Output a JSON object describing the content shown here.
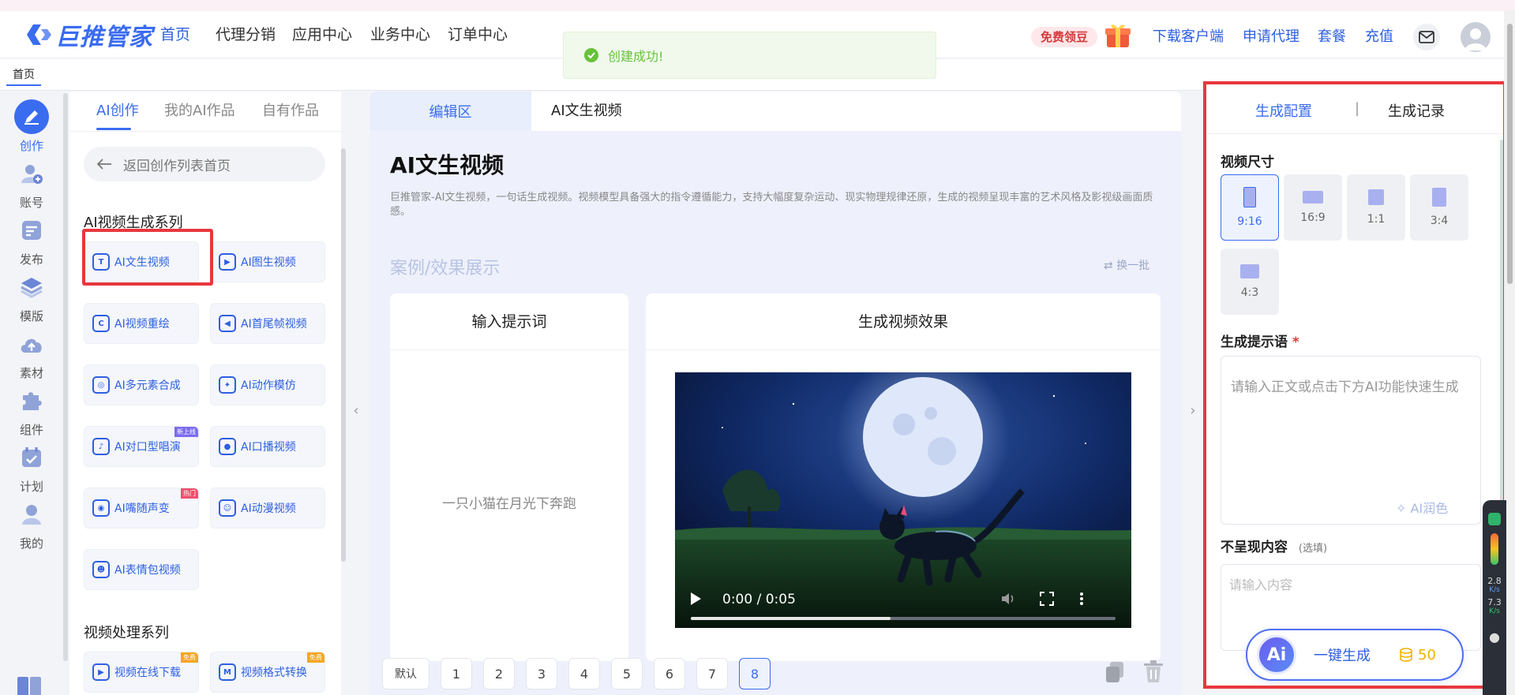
{
  "app": {
    "logo_text": "巨推管家",
    "accent_color": "#3a6cf0",
    "highlight_color": "#e8383d",
    "toast": {
      "text": "创建成功!",
      "icon": "check-circle-icon",
      "color": "#67c23a"
    }
  },
  "header": {
    "nav": [
      "首页",
      "代理分销",
      "应用中心",
      "业务中心",
      "订单中心"
    ],
    "free_beans": "免费领豆",
    "links": [
      "下载客户端",
      "申请代理",
      "套餐",
      "充值"
    ]
  },
  "tabbar": {
    "home_tab": "首页"
  },
  "rail": {
    "items": [
      {
        "label": "创作",
        "icon": "pen-icon"
      },
      {
        "label": "账号",
        "icon": "user-add-icon"
      },
      {
        "label": "发布",
        "icon": "publish-icon"
      },
      {
        "label": "模版",
        "icon": "layers-icon"
      },
      {
        "label": "素材",
        "icon": "cloud-upload-icon"
      },
      {
        "label": "组件",
        "icon": "puzzle-icon"
      },
      {
        "label": "计划",
        "icon": "calendar-check-icon"
      },
      {
        "label": "我的",
        "icon": "person-icon"
      }
    ]
  },
  "leftpanel": {
    "tabs": [
      "AI创作",
      "我的AI作品",
      "自有作品"
    ],
    "back_label": "返回创作列表首页",
    "section1_title": "AI视频生成系列",
    "section1_items": [
      {
        "label": "AI文生视频",
        "badge": ""
      },
      {
        "label": "AI图生视频",
        "badge": ""
      },
      {
        "label": "AI视频重绘",
        "badge": ""
      },
      {
        "label": "AI首尾帧视频",
        "badge": ""
      },
      {
        "label": "AI多元素合成",
        "badge": ""
      },
      {
        "label": "AI动作模仿",
        "badge": ""
      },
      {
        "label": "AI对口型唱演",
        "badge": "新上线"
      },
      {
        "label": "AI口播视频",
        "badge": ""
      },
      {
        "label": "AI嘴随声变",
        "badge": "热门"
      },
      {
        "label": "AI动漫视频",
        "badge": ""
      },
      {
        "label": "AI表情包视频",
        "badge": ""
      }
    ],
    "section2_title": "视频处理系列",
    "section2_items": [
      {
        "label": "视频在线下载",
        "badge": "免费"
      },
      {
        "label": "视频格式转换",
        "badge": "免费"
      }
    ]
  },
  "center": {
    "tabs": [
      "编辑区",
      "AI文生视频"
    ],
    "title": "AI文生视频",
    "description": "巨推管家-AI文生视频，一句话生成视频。视频模型具备强大的指令遵循能力，支持大幅度复杂运动、现实物理规律还原，生成的视频呈现丰富的艺术风格及影视级画面质感。",
    "case_title": "案例/效果展示",
    "refresh_label": "换一批",
    "input_card_title": "输入提示词",
    "output_card_title": "生成视频效果",
    "prompt_example": "一只小猫在月光下奔跑",
    "video": {
      "time": "0:00 / 0:05",
      "progress": 0.47
    },
    "pagination": [
      "默认",
      "1",
      "2",
      "3",
      "4",
      "5",
      "6",
      "7",
      "8"
    ],
    "current_page": "8"
  },
  "rightpanel": {
    "tabs": [
      "生成配置",
      "|",
      "生成记录"
    ],
    "size_label": "视频尺寸",
    "sizes": [
      "9:16",
      "16:9",
      "1:1",
      "3:4",
      "4:3"
    ],
    "selected_size": "9:16",
    "prompt_label": "生成提示语",
    "required_mark": "*",
    "prompt_placeholder": "请输入正文或点击下方AI功能快速生成",
    "ai_polish": "AI润色",
    "negative_label": "不呈现内容",
    "negative_optional": "(选填)",
    "negative_placeholder": "请输入内容",
    "generate_label": "一键生成",
    "generate_ai": "Ai",
    "generate_cost": "50"
  },
  "sidewidget": {
    "v1": "2.8",
    "u1": "K/s",
    "v2": "7.3",
    "u2": "K/s"
  }
}
